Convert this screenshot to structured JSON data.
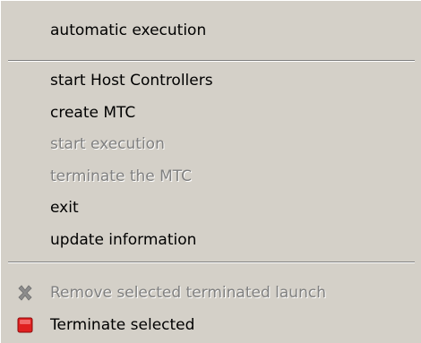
{
  "menu": {
    "automatic_execution": "automatic execution",
    "start_host_controllers": "start Host Controllers",
    "create_mtc": "create MTC",
    "start_execution": "start execution",
    "terminate_mtc": "terminate the MTC",
    "exit": "exit",
    "update_information": "update information",
    "remove_selected": "Remove selected terminated launch",
    "terminate_selected": "Terminate selected"
  },
  "icons": {
    "remove": "remove-x-icon",
    "terminate": "terminate-red-square-icon"
  },
  "colors": {
    "menu_bg": "#d4d0c8",
    "disabled_text": "#808080",
    "terminate_red": "#e02020"
  }
}
